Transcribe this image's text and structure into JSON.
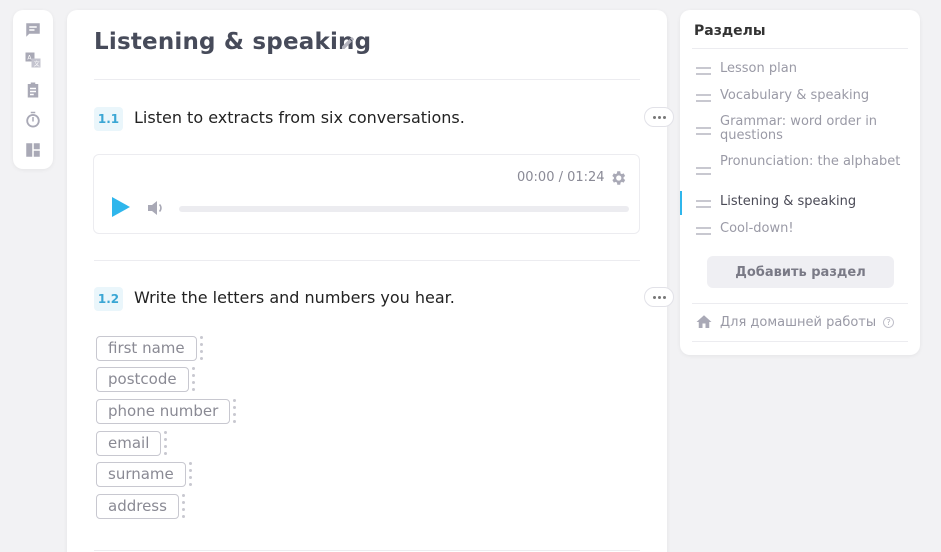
{
  "toolbar": {
    "icons": [
      "chat-icon",
      "translate-icon",
      "clipboard-icon",
      "stopwatch-icon",
      "layout-icon"
    ]
  },
  "main": {
    "title": "Listening & speaking",
    "exercises": [
      {
        "number": "1.1",
        "title": "Listen to extracts from six conversations."
      },
      {
        "number": "1.2",
        "title": "Write the letters and numbers you hear."
      }
    ],
    "player": {
      "time": "00:00 / 01:24",
      "progress": 0
    },
    "chips": [
      "first name",
      "postcode",
      "phone number",
      "email",
      "surname",
      "address"
    ]
  },
  "sidebar": {
    "title": "Разделы",
    "sections": [
      {
        "label": "Lesson plan",
        "active": false
      },
      {
        "label": "Vocabulary & speaking",
        "active": false
      },
      {
        "label": "Grammar: word order in questions",
        "active": false
      },
      {
        "label": "Pronunciation: the alphabet",
        "active": false
      },
      {
        "label": "Listening & speaking",
        "active": true
      },
      {
        "label": "Cool-down!",
        "active": false
      }
    ],
    "add_button": "Добавить раздел",
    "homework_label": "Для домашней работы",
    "help_mark": "?"
  },
  "colors": {
    "accent": "#2fb6ec",
    "number_badge_bg": "#eaf6fb",
    "number_badge_text": "#3aa6d4"
  }
}
